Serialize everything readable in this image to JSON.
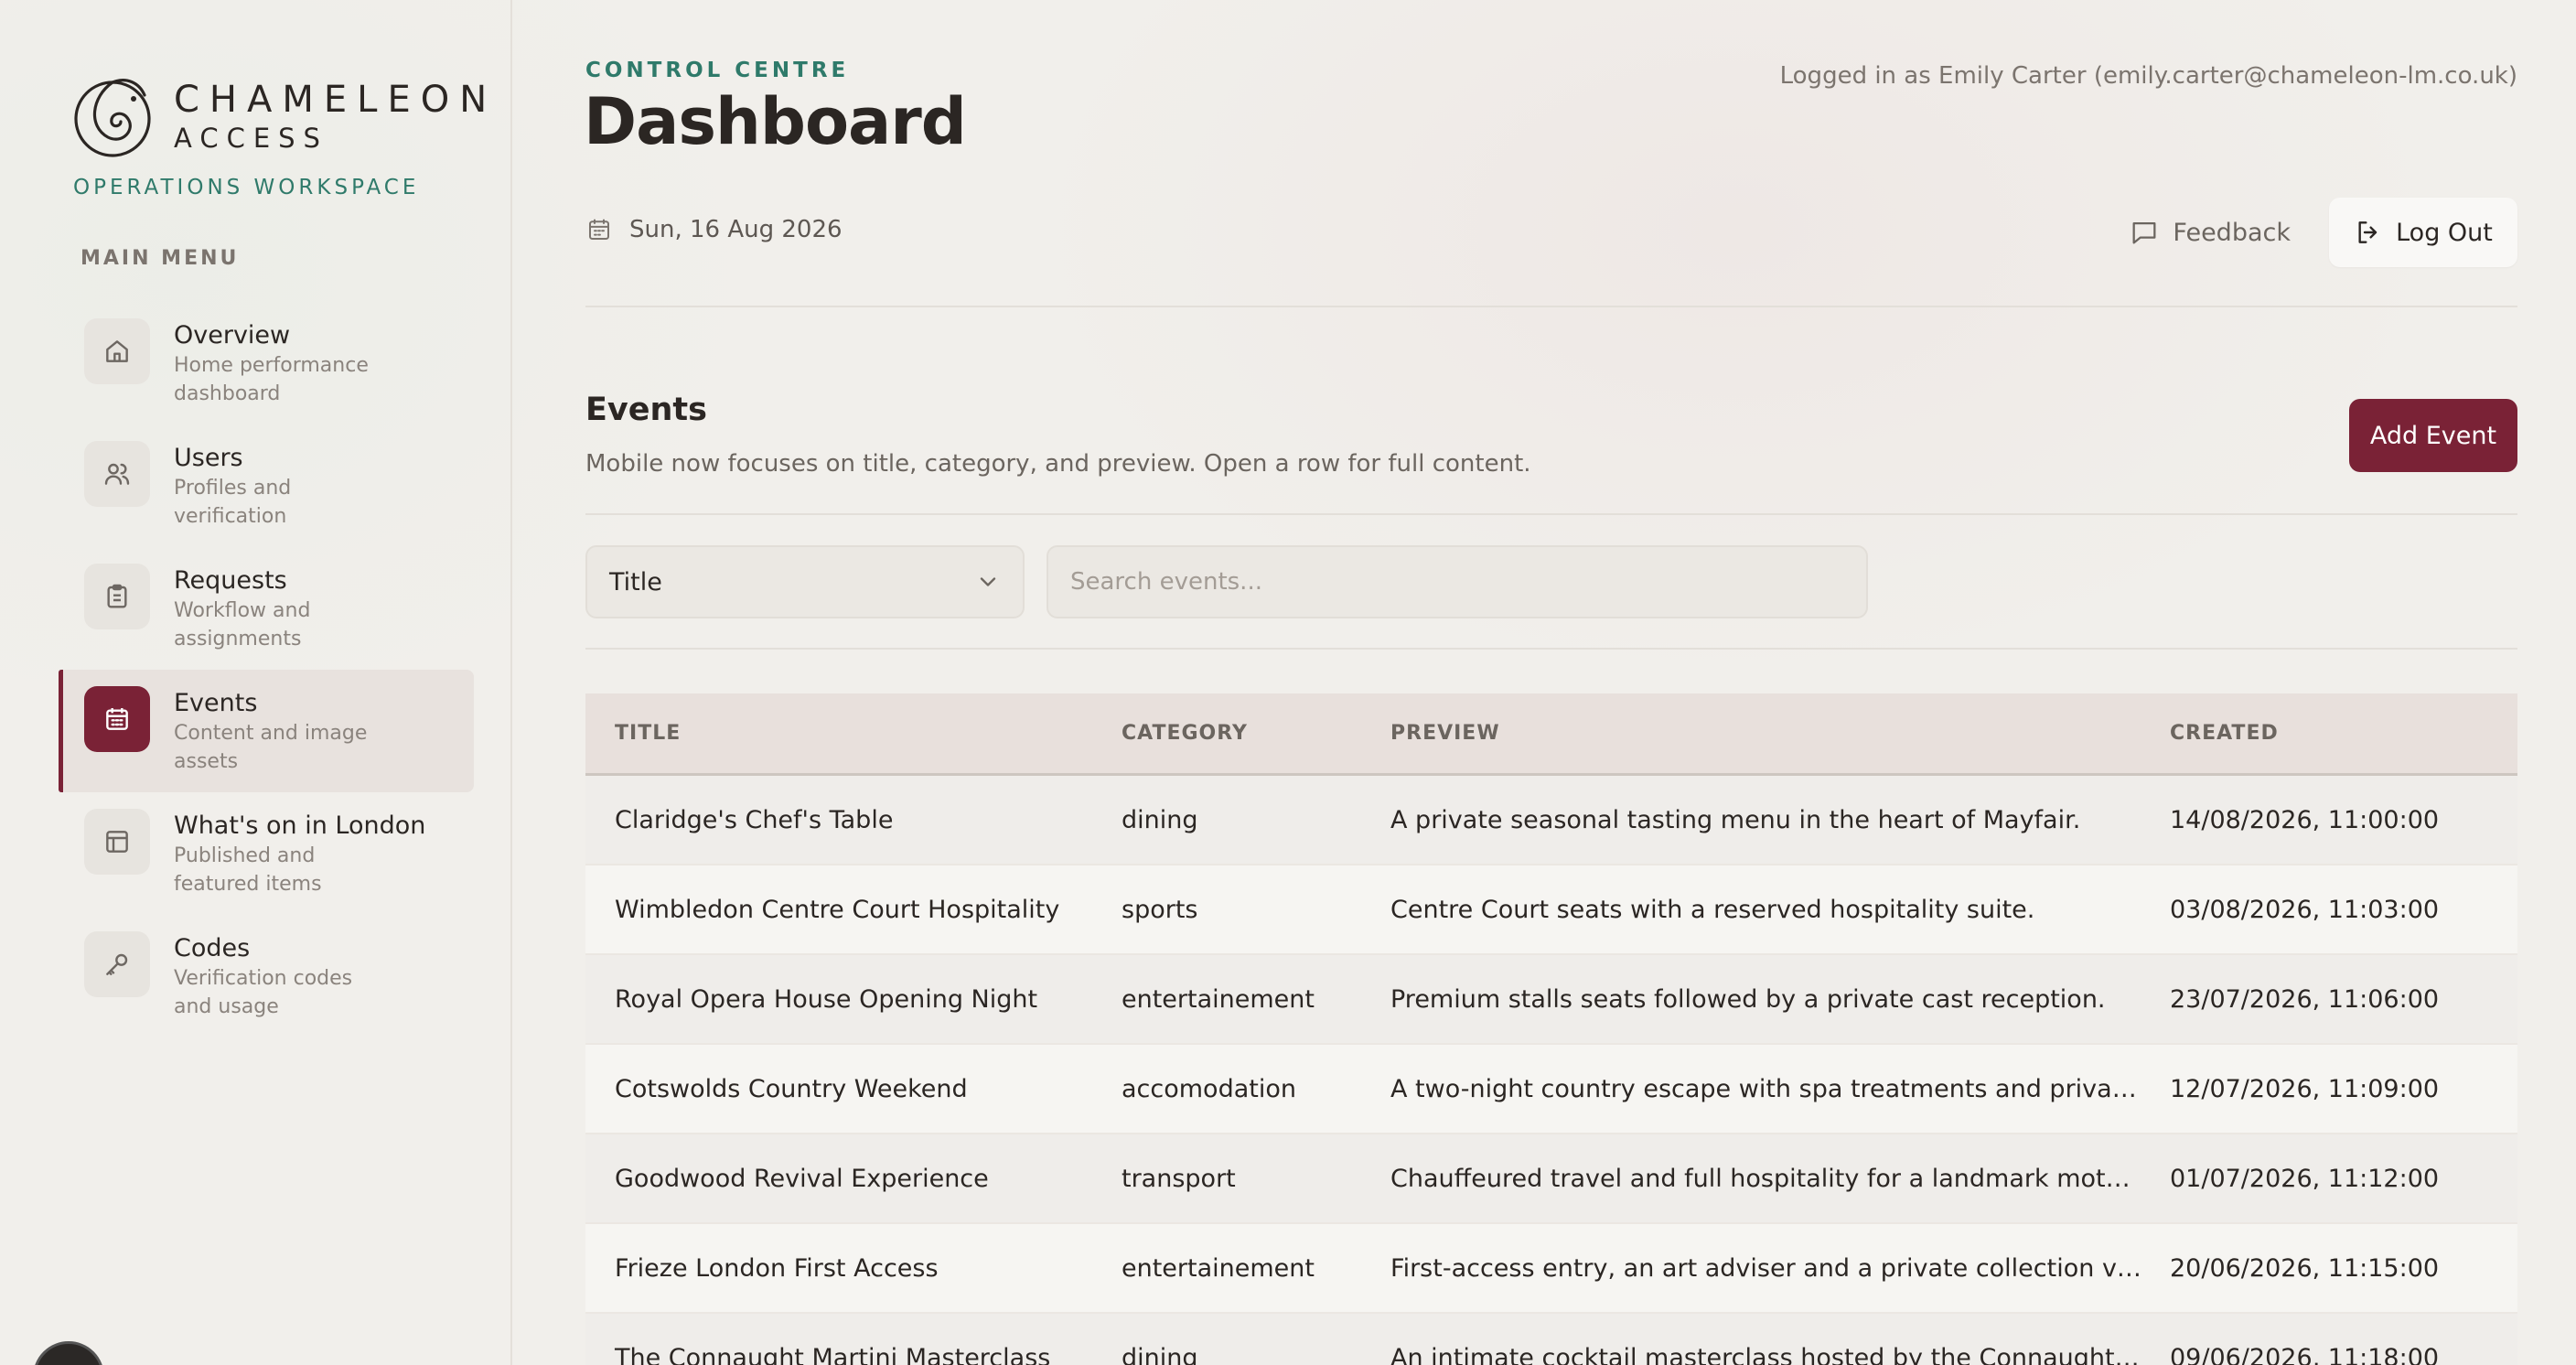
{
  "brand": {
    "name_line1": "CHAMELEON",
    "name_line2": "ACCESS",
    "workspace": "OPERATIONS WORKSPACE"
  },
  "sidebar": {
    "menu_title": "MAIN MENU",
    "items": [
      {
        "label": "Overview",
        "desc": "Home performance dashboard",
        "icon": "home-icon"
      },
      {
        "label": "Users",
        "desc": "Profiles and verification",
        "icon": "users-icon"
      },
      {
        "label": "Requests",
        "desc": "Workflow and assignments",
        "icon": "clipboard-icon"
      },
      {
        "label": "Events",
        "desc": "Content and image assets",
        "icon": "calendar-icon",
        "active": true
      },
      {
        "label": "What's on in London",
        "desc": "Published and featured items",
        "icon": "layout-icon"
      },
      {
        "label": "Codes",
        "desc": "Verification codes and usage",
        "icon": "key-icon"
      }
    ]
  },
  "header": {
    "eyebrow": "CONTROL CENTRE",
    "title": "Dashboard",
    "logged_in": "Logged in as Emily Carter (emily.carter@chameleon-lm.co.uk)",
    "date": "Sun, 16 Aug 2026",
    "feedback_label": "Feedback",
    "logout_label": "Log Out"
  },
  "events": {
    "title": "Events",
    "subtitle": "Mobile now focuses on title, category, and preview. Open a row for full content.",
    "add_label": "Add Event",
    "filter_value": "Title",
    "search_placeholder": "Search events...",
    "columns": [
      "TITLE",
      "CATEGORY",
      "PREVIEW",
      "CREATED"
    ],
    "rows": [
      {
        "title": "Claridge's Chef's Table",
        "category": "dining",
        "preview": "A private seasonal tasting menu in the heart of Mayfair.",
        "created": "14/08/2026, 11:00:00"
      },
      {
        "title": "Wimbledon Centre Court Hospitality",
        "category": "sports",
        "preview": "Centre Court seats with a reserved hospitality suite.",
        "created": "03/08/2026, 11:03:00"
      },
      {
        "title": "Royal Opera House Opening Night",
        "category": "entertainement",
        "preview": "Premium stalls seats followed by a private cast reception.",
        "created": "23/07/2026, 11:06:00"
      },
      {
        "title": "Cotswolds Country Weekend",
        "category": "accomodation",
        "preview": "A two-night country escape with spa treatments and private din...",
        "created": "12/07/2026, 11:09:00"
      },
      {
        "title": "Goodwood Revival Experience",
        "category": "transport",
        "preview": "Chauffeured travel and full hospitality for a landmark motoring ...",
        "created": "01/07/2026, 11:12:00"
      },
      {
        "title": "Frieze London First Access",
        "category": "entertainement",
        "preview": "First-access entry, an art adviser and a private collection visit.",
        "created": "20/06/2026, 11:15:00"
      },
      {
        "title": "The Connaught Martini Masterclass",
        "category": "dining",
        "preview": "An intimate cocktail masterclass hosted by the Connaught Bar t...",
        "created": "09/06/2026, 11:18:00"
      }
    ]
  },
  "colors": {
    "accent": "#7a2236",
    "teal": "#2f7a6a",
    "background": "#f1efeb"
  }
}
